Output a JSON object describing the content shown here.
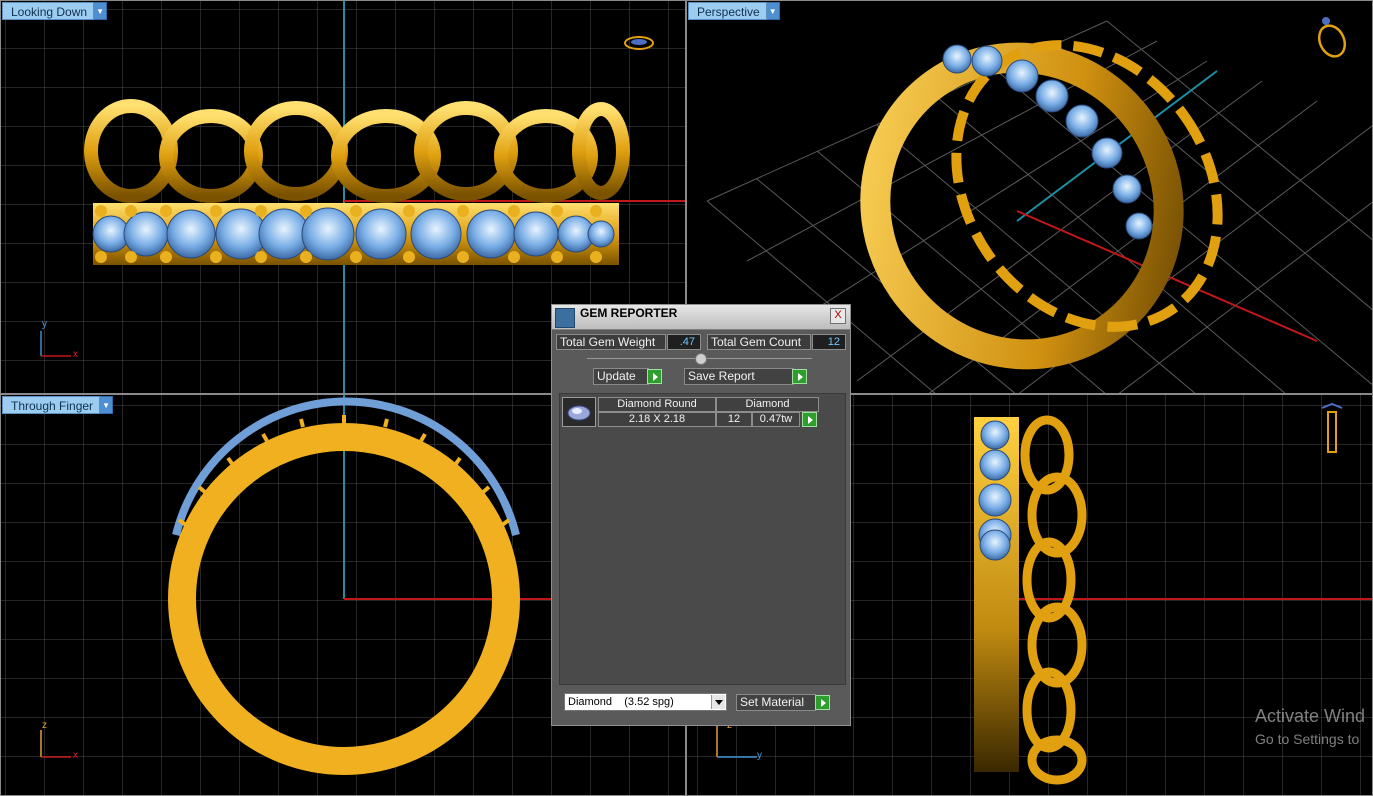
{
  "viewports": {
    "top_left": {
      "label": "Looking Down"
    },
    "top_right": {
      "label": "Perspective"
    },
    "bottom_left": {
      "label": "Through Finger"
    },
    "bottom_right": {
      "label": ""
    }
  },
  "axis_labels": {
    "top_left": {
      "vertical": "y",
      "horizontal": "x"
    },
    "bottom_left": {
      "vertical": "z",
      "horizontal": "x"
    },
    "bottom_right": {
      "vertical": "z",
      "horizontal": "y"
    }
  },
  "gem_reporter": {
    "title": "GEM REPORTER",
    "close_label": "X",
    "total_weight_label": "Total Gem Weight",
    "total_weight_value": ".47",
    "total_count_label": "Total Gem Count",
    "total_count_value": "12",
    "update_label": "Update",
    "save_report_label": "Save Report",
    "rows": [
      {
        "shape": "Diamond Round",
        "size": "2.18 X 2.18",
        "material": "Diamond",
        "count": "12",
        "weight": "0.47tw"
      }
    ],
    "material_select": "Diamond    (3.52 spg)",
    "set_material_label": "Set Material"
  },
  "watermark": {
    "line1": "Activate Wind",
    "line2": "Go to Settings to"
  },
  "colors": {
    "gold": "#e0a010",
    "gem_blue": "#7aaee6",
    "grid": "#4d4d4d",
    "axis_red": "#c01818",
    "axis_cyan": "#1f8fa8",
    "label_bg": "#9ccdf0"
  }
}
